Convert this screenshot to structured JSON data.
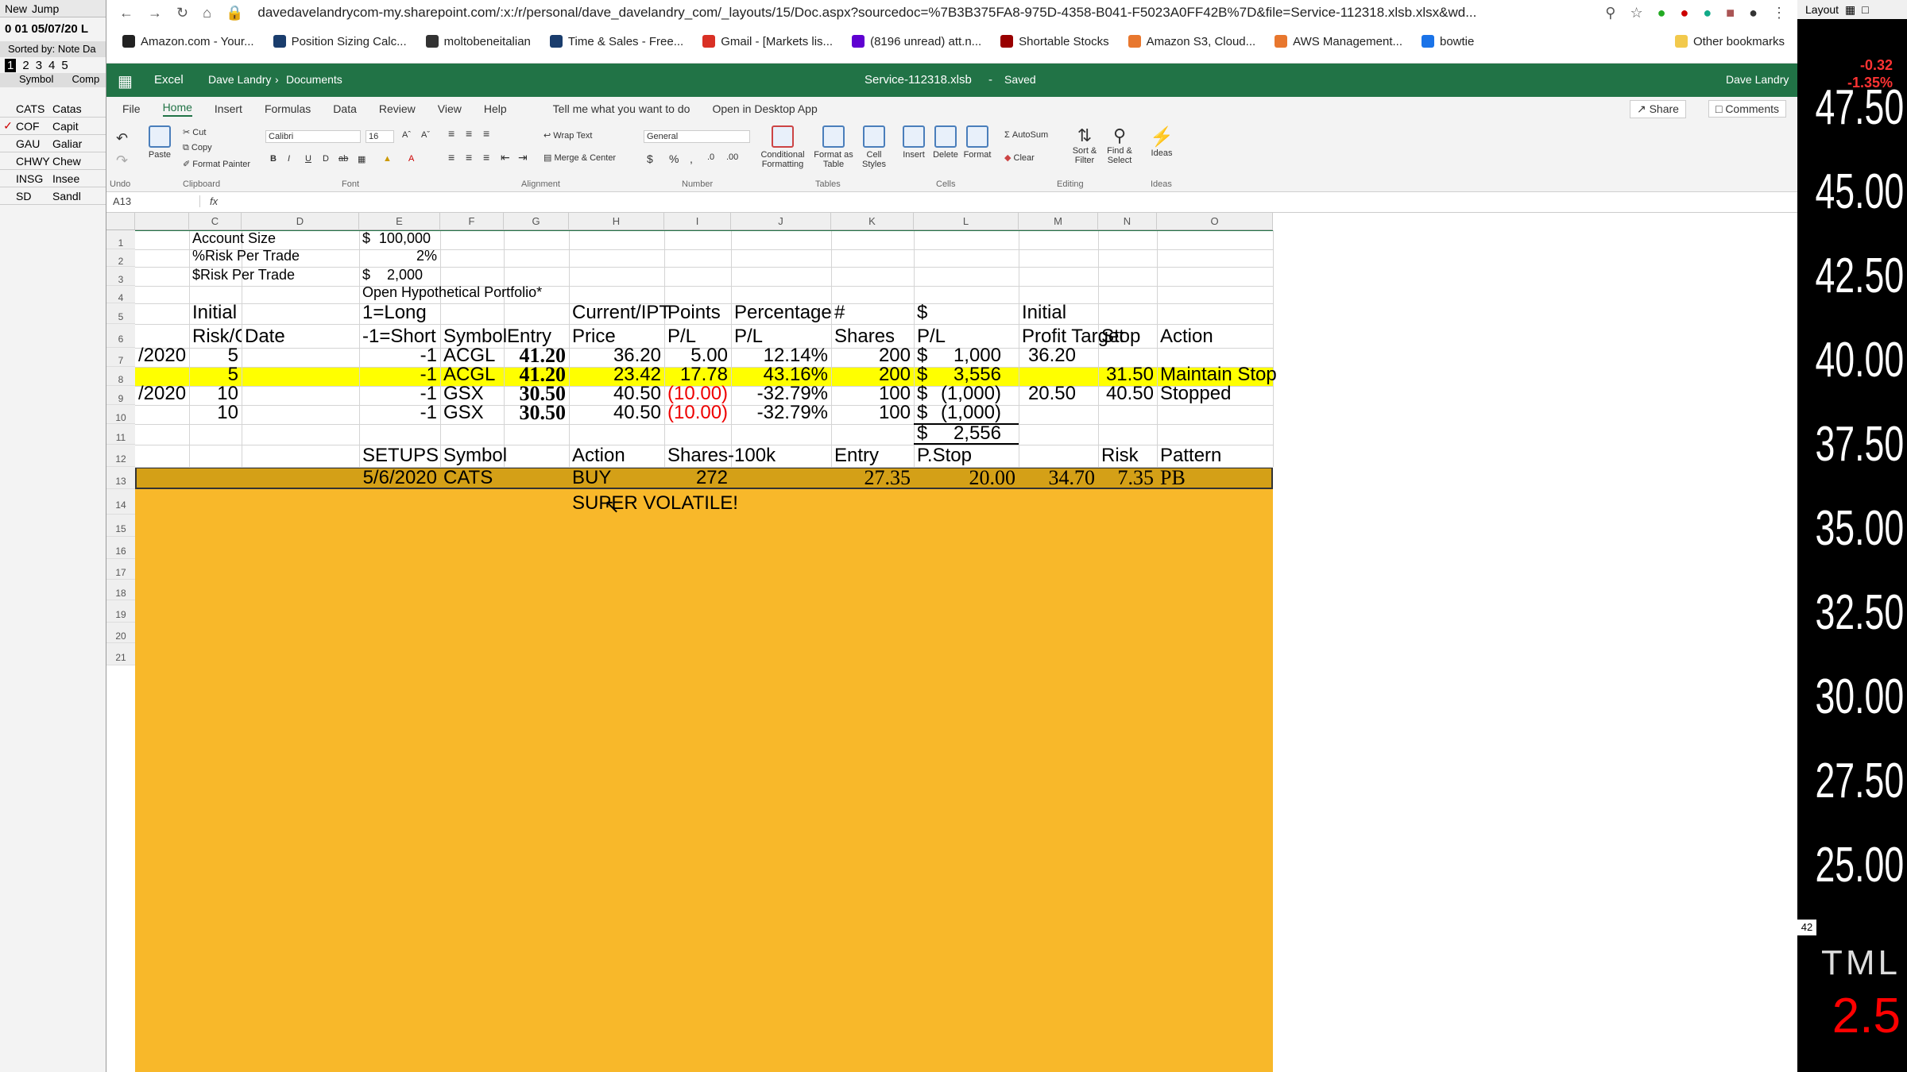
{
  "left_panel": {
    "toolbar": [
      "New",
      "Jump"
    ],
    "date_line": "0 01 05/07/20 L",
    "sorted_by": "Sorted by: Note Da",
    "tabs": [
      "1",
      "2",
      "3",
      "4",
      "5"
    ],
    "columns": [
      "Symbol",
      "Comp"
    ],
    "rows": [
      {
        "symbol": "CATS",
        "company": "Catas",
        "checked": false
      },
      {
        "symbol": "COF",
        "company": "Capit",
        "checked": true
      },
      {
        "symbol": "GAU",
        "company": "Galiar",
        "checked": false
      },
      {
        "symbol": "CHWY",
        "company": "Chew",
        "checked": false
      },
      {
        "symbol": "INSG",
        "company": "Insee",
        "checked": false
      },
      {
        "symbol": "SD",
        "company": "Sandl",
        "checked": false
      }
    ]
  },
  "right_chart": {
    "top": "Layout",
    "change": [
      "-0.32",
      "-1.35%"
    ],
    "prices": [
      "47.50",
      "45.00",
      "42.50",
      "40.00",
      "37.50",
      "35.00",
      "32.50",
      "30.00",
      "27.50",
      "25.00"
    ],
    "small_label": "42",
    "ticker": "TML",
    "last": "2.5"
  },
  "browser": {
    "url": "davedavelandrycom-my.sharepoint.com/:x:/r/personal/dave_davelandry_com/_layouts/15/Doc.aspx?sourcedoc=%7B3B375FA8-975D-4358-B041-F5023A0FF42B%7D&file=Service-112318.xlsb.xlsx&wd...",
    "bookmarks": [
      {
        "label": "Amazon.com - Your...",
        "color": "#222"
      },
      {
        "label": "Position Sizing Calc...",
        "color": "#1a3d6d"
      },
      {
        "label": "moltobeneitalian",
        "color": "#333"
      },
      {
        "label": "Time & Sales - Free...",
        "color": "#1a3d6d"
      },
      {
        "label": "Gmail - [Markets lis...",
        "color": "#d93025"
      },
      {
        "label": "(8196 unread) att.n...",
        "color": "#5f01d1"
      },
      {
        "label": "Shortable Stocks",
        "color": "#900"
      },
      {
        "label": "Amazon S3, Cloud...",
        "color": "#e8772e"
      },
      {
        "label": "AWS Management...",
        "color": "#e8772e"
      },
      {
        "label": "bowtie",
        "color": "#1a73e8"
      }
    ],
    "other_bookmarks": "Other bookmarks"
  },
  "excel": {
    "app": "Excel",
    "breadcrumb": [
      "Dave Landry",
      "Documents"
    ],
    "file": "Service-112318.xlsb",
    "status": "Saved",
    "user": "Dave Landry",
    "tabs": [
      "File",
      "Home",
      "Insert",
      "Formulas",
      "Data",
      "Review",
      "View",
      "Help",
      "Tell me what you want to do",
      "Open in Desktop App"
    ],
    "share": "Share",
    "comments": "Comments",
    "ribbon": {
      "paste": "Paste",
      "cut": "Cut",
      "copy": "Copy",
      "format_painter": "Format Painter",
      "font": "Calibri",
      "size": "16",
      "wrap": "Wrap Text",
      "merge": "Merge & Center",
      "number_format": "General",
      "cond": "Conditional Formatting",
      "table": "Format as Table",
      "styles": "Cell Styles",
      "insert": "Insert",
      "delete": "Delete",
      "format": "Format",
      "autosum": "AutoSum",
      "clear": "Clear",
      "sort": "Sort & Filter",
      "find": "Find & Select",
      "ideas": "Ideas",
      "groups": [
        "Undo",
        "Clipboard",
        "Font",
        "Alignment",
        "Number",
        "Tables",
        "Cells",
        "Editing",
        "Ideas"
      ]
    },
    "name_box": "A13",
    "fx": "fx",
    "columns": [
      "C",
      "D",
      "E",
      "F",
      "G",
      "H",
      "I",
      "J",
      "K",
      "L",
      "M",
      "N",
      "O"
    ],
    "rows": [
      "1",
      "2",
      "3",
      "4",
      "5",
      "6",
      "7",
      "8",
      "9",
      "10",
      "11",
      "12",
      "13",
      "14",
      "15",
      "16",
      "17",
      "18",
      "19",
      "20",
      "21"
    ],
    "cells": {
      "r1_label": "Account Size",
      "r1_cur": "$",
      "r1_val": "100,000",
      "r2_label": "%Risk Per Trade",
      "r2_val": "2%",
      "r3_label": "$Risk Per Trade",
      "r3_cur": "$",
      "r3_val": "2,000",
      "r4": "Open Hypothetical Portfolio*",
      "h_initial": "Initial",
      "h_riskgoal": "Risk/Goal",
      "h_date": "Date",
      "h_long": "1=Long",
      "h_short": "-1=Short",
      "h_symbol": "Symbol",
      "h_entry": "Entry",
      "h_cur": "Current/IPT",
      "h_price": "Price",
      "h_points": "Points",
      "h_pl": "P/L",
      "h_pct": "Percentage",
      "h_pct_pl": "P/L",
      "h_num": "#",
      "h_shares": "Shares",
      "h_dollar": "$",
      "h_dollar_pl": "P/L",
      "h_initial2": "Initial",
      "h_profit": "Profit Target",
      "h_stop": "Stop",
      "h_action": "Action",
      "trades": [
        {
          "date": "/2020",
          "risk": "5",
          "dir": "-1",
          "symbol": "ACGL",
          "entry": "41.20",
          "price": "36.20",
          "points": "5.00",
          "pct": "12.14%",
          "shares": "200",
          "cur": "$",
          "pl": "1,000",
          "target": "36.20",
          "stop": "",
          "action": ""
        },
        {
          "date": "",
          "risk": "5",
          "dir": "-1",
          "symbol": "ACGL",
          "entry": "41.20",
          "price": "23.42",
          "points": "17.78",
          "pct": "43.16%",
          "shares": "200",
          "cur": "$",
          "pl": "3,556",
          "target": "",
          "stop": "31.50",
          "action": "Maintain Stop"
        },
        {
          "date": "/2020",
          "risk": "10",
          "dir": "-1",
          "symbol": "GSX",
          "entry": "30.50",
          "price": "40.50",
          "points": "(10.00)",
          "pct": "-32.79%",
          "shares": "100",
          "cur": "$",
          "pl": "(1,000)",
          "target": "20.50",
          "stop": "40.50",
          "action": "Stopped"
        },
        {
          "date": "",
          "risk": "10",
          "dir": "-1",
          "symbol": "GSX",
          "entry": "30.50",
          "price": "40.50",
          "points": "(10.00)",
          "pct": "-32.79%",
          "shares": "100",
          "cur": "$",
          "pl": "(1,000)",
          "target": "",
          "stop": "",
          "action": ""
        }
      ],
      "total_cur": "$",
      "total": "2,556",
      "s_setups": "SETUPS",
      "s_symbol": "Symbol",
      "s_action": "Action",
      "s_shares": "Shares-100k",
      "s_entry": "Entry",
      "s_pstop": "P.Stop",
      "s_risk": "Risk",
      "s_pattern": "Pattern",
      "setup": {
        "date": "5/6/2020",
        "symbol": "CATS",
        "action": "BUY",
        "shares": "272",
        "entry": "27.35",
        "pstop": "20.00",
        "m": "34.70",
        "risk": "7.35",
        "pattern": "PB"
      },
      "note": "SUPER VOLATILE!"
    },
    "colors": {
      "green": "#217346",
      "yellow": "#ffff00",
      "gold": "#d4a017",
      "orange": "#f8b82a",
      "red": "#e00000"
    }
  }
}
